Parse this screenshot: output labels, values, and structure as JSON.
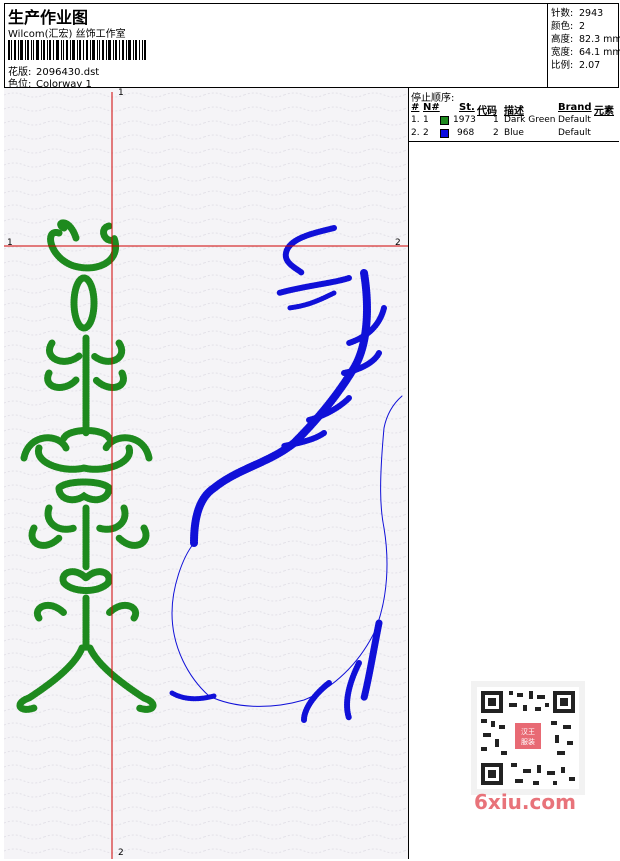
{
  "header": {
    "title": "生产作业图",
    "subtitle": "Wilcom(汇宏) 丝饰工作室",
    "design_label": "花版:",
    "design_value": "2096430.dst",
    "colorway_label": "色位:",
    "colorway_value": "Colorway 1"
  },
  "stats": [
    {
      "label": "针数:",
      "value": "2943"
    },
    {
      "label": "颜色:",
      "value": "2"
    },
    {
      "label": "高度:",
      "value": "82.3 mm"
    },
    {
      "label": "宽度:",
      "value": "64.1 mm"
    },
    {
      "label": "比例:",
      "value": "2.07"
    }
  ],
  "stop_sequence": {
    "title": "停止顺序:",
    "columns": [
      "#",
      "N#",
      "St.",
      "代码",
      "描述",
      "Brand",
      "元素"
    ],
    "rows": [
      {
        "index": "1.",
        "n": "1",
        "color": "#1e8a1e",
        "stitches": "1973",
        "code": "1",
        "description": "Dark Green",
        "brand": "Default"
      },
      {
        "index": "2.",
        "n": "2",
        "color": "#0a0ae0",
        "stitches": "968",
        "code": "2",
        "description": "Blue",
        "brand": "Default"
      }
    ]
  },
  "guides": {
    "v_top": "1",
    "v_bottom": "2",
    "h_left": "1",
    "h_right": "2"
  },
  "watermark": {
    "site": "6xiu.com",
    "seal": "汉王服装"
  },
  "colors": {
    "green_thread": "#1e8a1e",
    "blue_thread": "#1010d8",
    "guide_red": "#d00000",
    "guide_green": "#00a000"
  }
}
